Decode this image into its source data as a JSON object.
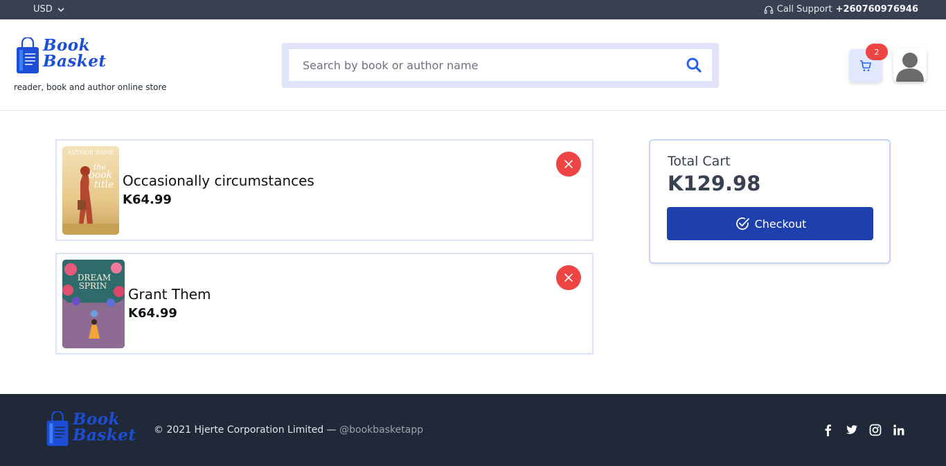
{
  "topbar": {
    "currency": "USD",
    "support_label": "Call Support",
    "support_phone": "+260760976946"
  },
  "brand": {
    "name_line1": "Book",
    "name_line2": "Basket",
    "tagline": "reader, book and author online store",
    "color": "#1d4ed8"
  },
  "search": {
    "placeholder": "Search by book or author name",
    "value": ""
  },
  "cart": {
    "count": "2",
    "items": [
      {
        "title": "Occasionally circumstances",
        "price": "K64.99",
        "cover": {
          "author": "AUTHOR NAME",
          "line1": "the",
          "line2": "book",
          "line3": "title"
        }
      },
      {
        "title": "Grant Them",
        "price": "K64.99",
        "cover": {
          "line1": "DREAM",
          "line2": "SPRIN"
        }
      }
    ],
    "total_label": "Total Cart",
    "total_value": "K129.98",
    "checkout_label": "Checkout"
  },
  "footer": {
    "copyright": "© 2021 Hjerte Corporation Limited —",
    "handle": "@bookbasketapp",
    "socials": [
      "facebook-icon",
      "twitter-icon",
      "instagram-icon",
      "linkedin-icon"
    ]
  },
  "colors": {
    "topbar_bg": "#374151",
    "footer_bg": "#1f2937",
    "primary": "#1e40af",
    "danger": "#ef4444",
    "accent_light": "#e0e7ff"
  }
}
